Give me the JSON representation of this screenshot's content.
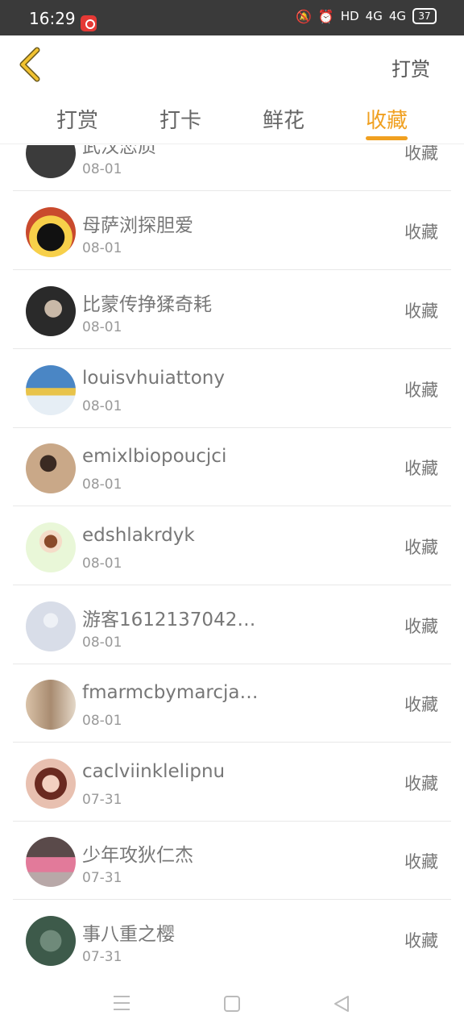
{
  "status_bar": {
    "time": "16:29",
    "network": "HD",
    "signal1": "4G",
    "signal2": "4G",
    "battery": "37"
  },
  "header": {
    "action_label": "打赏"
  },
  "tabs": [
    {
      "label": "打赏",
      "active": false
    },
    {
      "label": "打卡",
      "active": false
    },
    {
      "label": "鲜花",
      "active": false
    },
    {
      "label": "收藏",
      "active": true
    }
  ],
  "list": [
    {
      "name": "武汉恋质",
      "date": "08-01",
      "action": "收藏",
      "avatar_color": "#3b3b3b"
    },
    {
      "name": "母萨浏探胆爱",
      "date": "08-01",
      "action": "收藏",
      "avatar_color": "#c94a2d"
    },
    {
      "name": "比蒙传挣猱奇耗",
      "date": "08-01",
      "action": "收藏",
      "avatar_color": "#2a2a2a"
    },
    {
      "name": "louisvhuiattony",
      "date": "08-01",
      "action": "收藏",
      "avatar_color": "#4a86c5"
    },
    {
      "name": "emixlbiopoucjci",
      "date": "08-01",
      "action": "收藏",
      "avatar_color": "#b08a6a"
    },
    {
      "name": "edshlakrdyk",
      "date": "08-01",
      "action": "收藏",
      "avatar_color": "#d8f0c0"
    },
    {
      "name": "游客1612137042…",
      "date": "08-01",
      "action": "收藏",
      "avatar_color": "#d8dde8"
    },
    {
      "name": "fmarmcbymarcja…",
      "date": "08-01",
      "action": "收藏",
      "avatar_color": "#a88b70"
    },
    {
      "name": "caclviinklelipnu",
      "date": "07-31",
      "action": "收藏",
      "avatar_color": "#b0604a"
    },
    {
      "name": "少年攻狄仁杰",
      "date": "07-31",
      "action": "收藏",
      "avatar_color": "#8b6f6a"
    },
    {
      "name": "事八重之樱",
      "date": "07-31",
      "action": "收藏",
      "avatar_color": "#3d5a4a"
    }
  ],
  "accent_color": "#f0a020",
  "icons": {
    "back": "chevron-left-icon",
    "nav_menu": "menu-icon",
    "nav_home": "home-icon",
    "nav_back": "back-triangle-icon"
  }
}
